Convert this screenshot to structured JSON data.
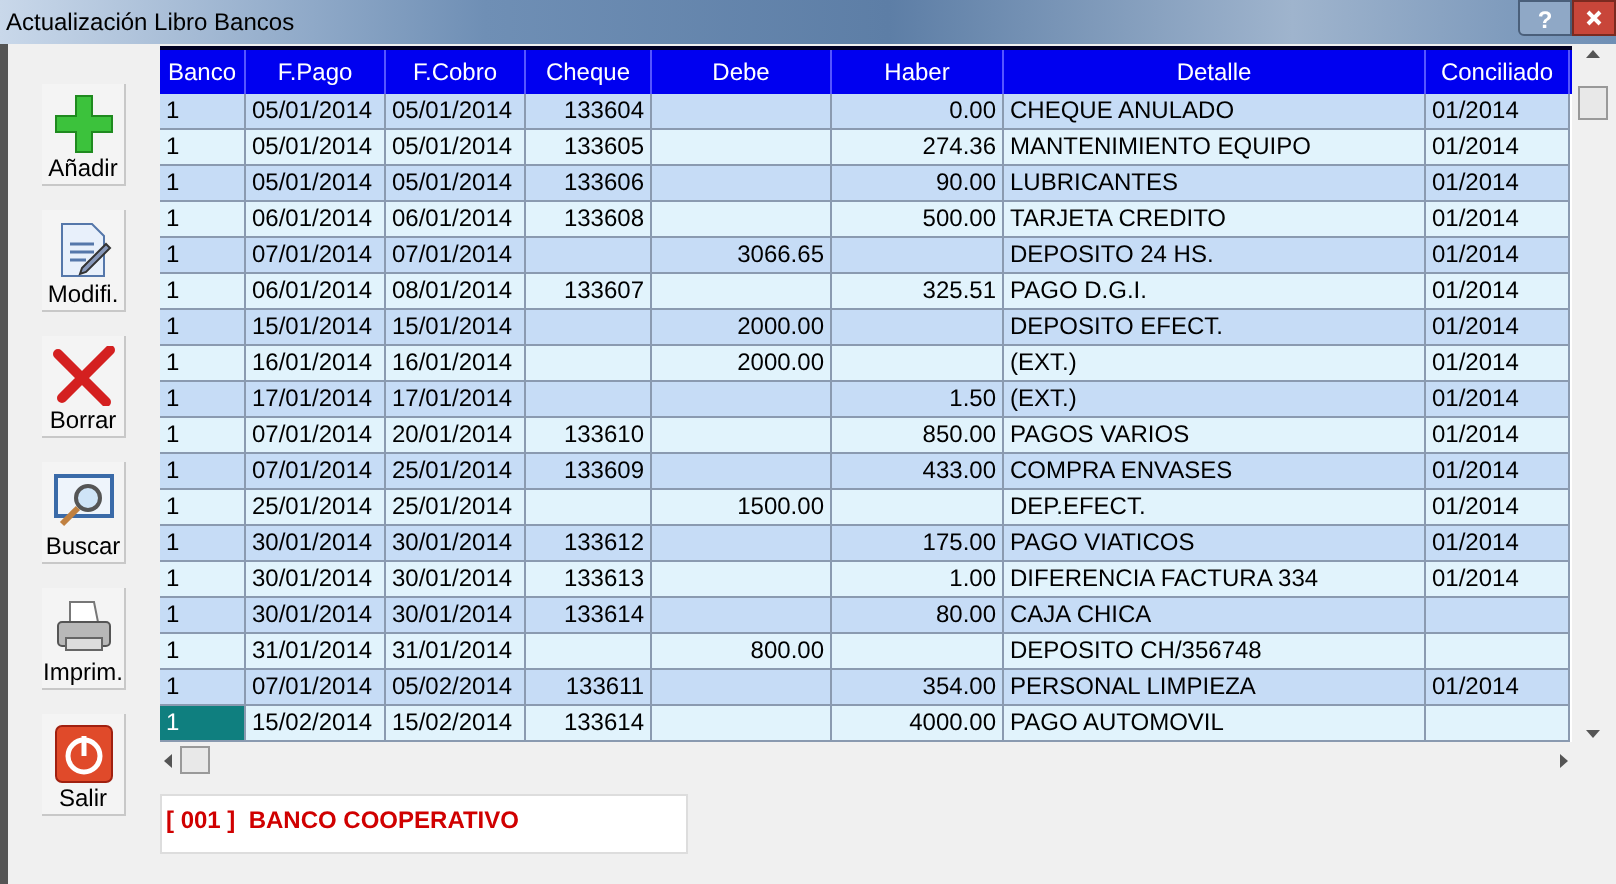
{
  "window": {
    "title": "Actualización Libro Bancos",
    "help": "?"
  },
  "toolbar": [
    {
      "kind": "add",
      "label": "Añadir"
    },
    {
      "kind": "edit",
      "label": "Modifi."
    },
    {
      "kind": "delete",
      "label": "Borrar"
    },
    {
      "kind": "search",
      "label": "Buscar"
    },
    {
      "kind": "print",
      "label": "Imprim."
    },
    {
      "kind": "exit",
      "label": "Salir"
    }
  ],
  "table": {
    "columns": [
      "Banco",
      "F.Pago",
      "F.Cobro",
      "Cheque",
      "Debe",
      "Haber",
      "Detalle",
      "Conciliado"
    ],
    "rows": [
      {
        "selected": false,
        "cells": [
          "1",
          "05/01/2014",
          "05/01/2014",
          "133604",
          "",
          "0.00",
          "CHEQUE ANULADO",
          "01/2014"
        ]
      },
      {
        "selected": false,
        "cells": [
          "1",
          "05/01/2014",
          "05/01/2014",
          "133605",
          "",
          "274.36",
          "MANTENIMIENTO EQUIPO",
          "01/2014"
        ]
      },
      {
        "selected": false,
        "cells": [
          "1",
          "05/01/2014",
          "05/01/2014",
          "133606",
          "",
          "90.00",
          "LUBRICANTES",
          "01/2014"
        ]
      },
      {
        "selected": false,
        "cells": [
          "1",
          "06/01/2014",
          "06/01/2014",
          "133608",
          "",
          "500.00",
          "TARJETA CREDITO",
          "01/2014"
        ]
      },
      {
        "selected": false,
        "cells": [
          "1",
          "07/01/2014",
          "07/01/2014",
          "",
          "3066.65",
          "",
          "DEPOSITO 24 HS.",
          "01/2014"
        ]
      },
      {
        "selected": false,
        "cells": [
          "1",
          "06/01/2014",
          "08/01/2014",
          "133607",
          "",
          "325.51",
          "PAGO D.G.I.",
          "01/2014"
        ]
      },
      {
        "selected": false,
        "cells": [
          "1",
          "15/01/2014",
          "15/01/2014",
          "",
          "2000.00",
          "",
          "DEPOSITO EFECT.",
          "01/2014"
        ]
      },
      {
        "selected": false,
        "cells": [
          "1",
          "16/01/2014",
          "16/01/2014",
          "",
          "2000.00",
          "",
          "(EXT.)",
          "01/2014"
        ]
      },
      {
        "selected": false,
        "cells": [
          "1",
          "17/01/2014",
          "17/01/2014",
          "",
          "",
          "1.50",
          "(EXT.)",
          "01/2014"
        ]
      },
      {
        "selected": false,
        "cells": [
          "1",
          "07/01/2014",
          "20/01/2014",
          "133610",
          "",
          "850.00",
          "PAGOS VARIOS",
          "01/2014"
        ]
      },
      {
        "selected": false,
        "cells": [
          "1",
          "07/01/2014",
          "25/01/2014",
          "133609",
          "",
          "433.00",
          "COMPRA ENVASES",
          "01/2014"
        ]
      },
      {
        "selected": false,
        "cells": [
          "1",
          "25/01/2014",
          "25/01/2014",
          "",
          "1500.00",
          "",
          "DEP.EFECT.",
          "01/2014"
        ]
      },
      {
        "selected": false,
        "cells": [
          "1",
          "30/01/2014",
          "30/01/2014",
          "133612",
          "",
          "175.00",
          "PAGO VIATICOS",
          "01/2014"
        ]
      },
      {
        "selected": false,
        "cells": [
          "1",
          "30/01/2014",
          "30/01/2014",
          "133613",
          "",
          "1.00",
          "DIFERENCIA FACTURA 334",
          "01/2014"
        ]
      },
      {
        "selected": false,
        "cells": [
          "1",
          "30/01/2014",
          "30/01/2014",
          "133614",
          "",
          "80.00",
          "CAJA CHICA",
          ""
        ]
      },
      {
        "selected": false,
        "cells": [
          "1",
          "31/01/2014",
          "31/01/2014",
          "",
          "800.00",
          "",
          "DEPOSITO CH/356748",
          ""
        ]
      },
      {
        "selected": false,
        "cells": [
          "1",
          "07/01/2014",
          "05/02/2014",
          "133611",
          "",
          "354.00",
          "PERSONAL LIMPIEZA",
          "01/2014"
        ]
      },
      {
        "selected": true,
        "cells": [
          "1",
          "15/02/2014",
          "15/02/2014",
          "133614",
          "",
          "4000.00",
          "PAGO AUTOMOVIL",
          ""
        ]
      }
    ]
  },
  "status": {
    "bank": "[ 001 ]  BANCO COOPERATIVO"
  }
}
